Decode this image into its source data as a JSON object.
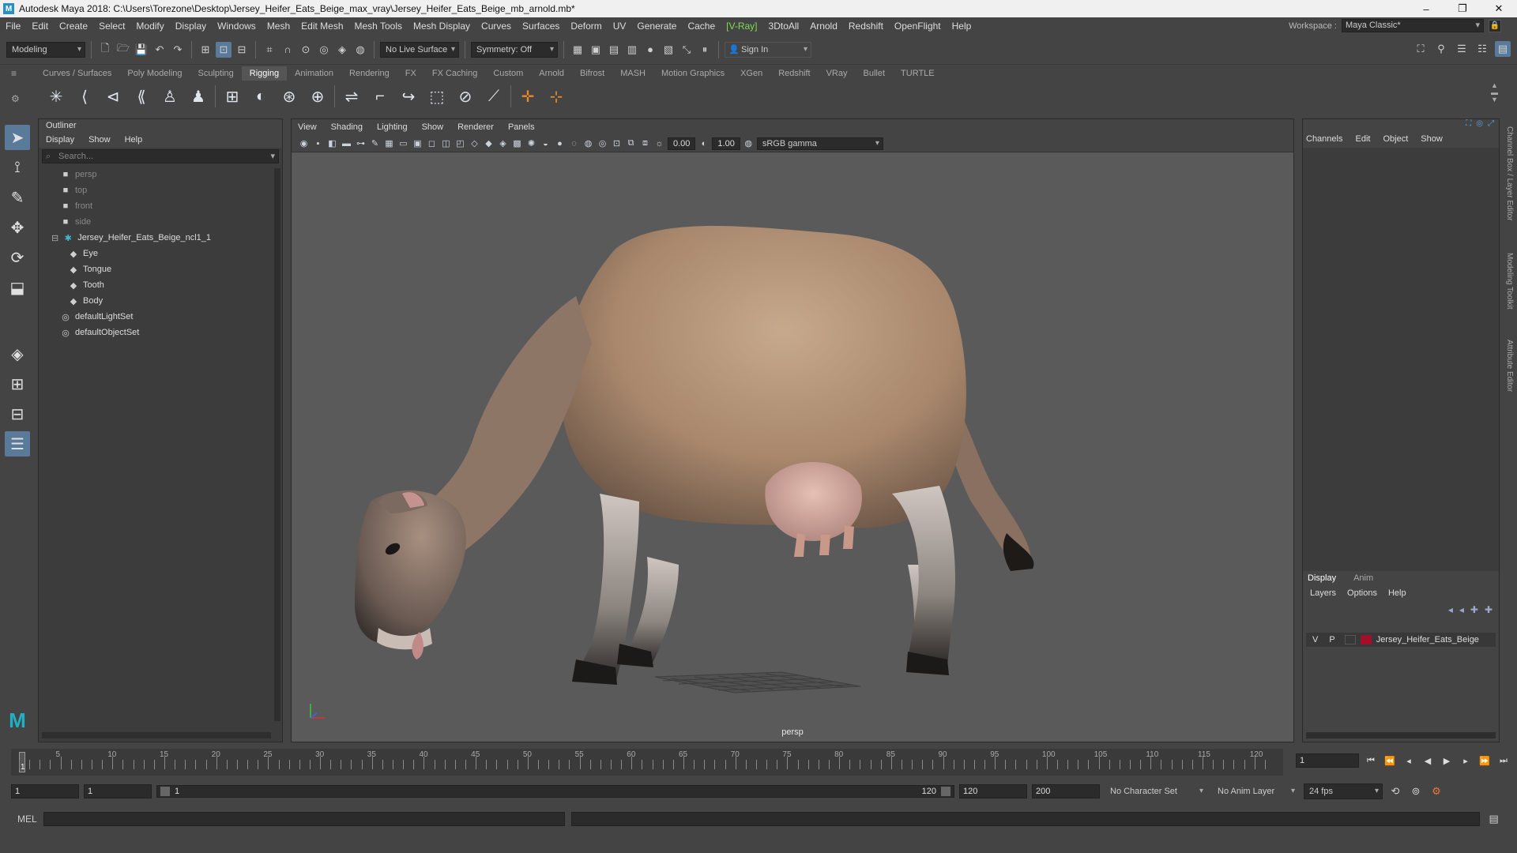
{
  "window": {
    "title": "Autodesk Maya 2018: C:\\Users\\Torezone\\Desktop\\Jersey_Heifer_Eats_Beige_max_vray\\Jersey_Heifer_Eats_Beige_mb_arnold.mb*",
    "icon": "M",
    "minimize": "–",
    "maximize": "❐",
    "close": "✕"
  },
  "menus": [
    "File",
    "Edit",
    "Create",
    "Select",
    "Modify",
    "Display",
    "Windows",
    "Mesh",
    "Edit Mesh",
    "Mesh Tools",
    "Mesh Display",
    "Curves",
    "Surfaces",
    "Deform",
    "UV",
    "Generate",
    "Cache",
    "[V-Ray]",
    "3DtoAll",
    "Arnold",
    "Redshift",
    "OpenFlight",
    "Help"
  ],
  "workspace": {
    "label": "Workspace :",
    "value": "Maya Classic*"
  },
  "statusline": {
    "mode": "Modeling",
    "live_surface": "No Live Surface",
    "symmetry": "Symmetry: Off",
    "sign_in": "Sign In"
  },
  "shelf_tabs": [
    "Curves / Surfaces",
    "Poly Modeling",
    "Sculpting",
    "Rigging",
    "Animation",
    "Rendering",
    "FX",
    "FX Caching",
    "Custom",
    "Arnold",
    "Bifrost",
    "MASH",
    "Motion Graphics",
    "XGen",
    "Redshift",
    "VRay",
    "Bullet",
    "TURTLE"
  ],
  "active_shelf": "Rigging",
  "shelf_icons": [
    "joint-tool-icon",
    "ik-handle-icon",
    "ik-spline-icon",
    "insert-joint-icon",
    "humanik-icon",
    "quick-rig-icon",
    "bind-skin-icon",
    "smooth-bind-icon",
    "wrap-icon",
    "cluster-icon",
    "lattice-icon",
    "blendshape-icon",
    "curve-warp-icon",
    "sculpt-deformer-icon",
    "orient-constraint-icon",
    "pole-vector-icon",
    "locator-icon",
    "cross-icon",
    "constraint-icon"
  ],
  "outliner": {
    "title": "Outliner",
    "menus": [
      "Display",
      "Show",
      "Help"
    ],
    "search_placeholder": "Search...",
    "items": [
      {
        "label": "persp",
        "icon": "camera-icon",
        "dim": true,
        "indent": 1
      },
      {
        "label": "top",
        "icon": "camera-icon",
        "dim": true,
        "indent": 1
      },
      {
        "label": "front",
        "icon": "camera-icon",
        "dim": true,
        "indent": 1
      },
      {
        "label": "side",
        "icon": "camera-icon",
        "dim": true,
        "indent": 1
      },
      {
        "label": "Jersey_Heifer_Eats_Beige_ncl1_1",
        "icon": "joint-icon",
        "dim": false,
        "indent": 0
      },
      {
        "label": "Eye",
        "icon": "mesh-icon",
        "dim": false,
        "indent": 2
      },
      {
        "label": "Tongue",
        "icon": "mesh-icon",
        "dim": false,
        "indent": 2
      },
      {
        "label": "Tooth",
        "icon": "mesh-icon",
        "dim": false,
        "indent": 2
      },
      {
        "label": "Body",
        "icon": "mesh-icon",
        "dim": false,
        "indent": 2
      },
      {
        "label": "defaultLightSet",
        "icon": "set-icon",
        "dim": false,
        "indent": 1
      },
      {
        "label": "defaultObjectSet",
        "icon": "set-icon",
        "dim": false,
        "indent": 1
      }
    ]
  },
  "viewport": {
    "menus": [
      "View",
      "Shading",
      "Lighting",
      "Show",
      "Renderer",
      "Panels"
    ],
    "exposure": "0.00",
    "gamma": "1.00",
    "color_space": "sRGB gamma",
    "camera_label": "persp"
  },
  "channel_box": {
    "menus": [
      "Channels",
      "Edit",
      "Object",
      "Show"
    ]
  },
  "layer_editor": {
    "tabs": [
      "Display",
      "Anim"
    ],
    "active_tab": "Display",
    "menus": [
      "Layers",
      "Options",
      "Help"
    ],
    "layer": {
      "v": "V",
      "p": "P",
      "name": "Jersey_Heifer_Eats_Beige",
      "color": "#a0102c"
    }
  },
  "side_tabs": [
    "Channel Box / Layer Editor",
    "Modeling Toolkit",
    "Attribute Editor"
  ],
  "timeline": {
    "ticks": [
      5,
      10,
      15,
      20,
      25,
      30,
      35,
      40,
      45,
      50,
      55,
      60,
      65,
      70,
      75,
      80,
      85,
      90,
      95,
      100,
      105,
      110,
      115,
      120
    ],
    "start_tick": 1,
    "current_frame": "1"
  },
  "range": {
    "start": "1",
    "playback_start": "1",
    "slider_start": "1",
    "slider_end": "120",
    "playback_end": "120",
    "end": "200",
    "character_set": "No Character Set",
    "anim_layer": "No Anim Layer",
    "fps": "24 fps"
  },
  "command_line": {
    "label": "MEL"
  },
  "colors": {
    "accent": "#5a7a9a",
    "vray": "#7ddc54",
    "layer_red": "#a0102c"
  }
}
